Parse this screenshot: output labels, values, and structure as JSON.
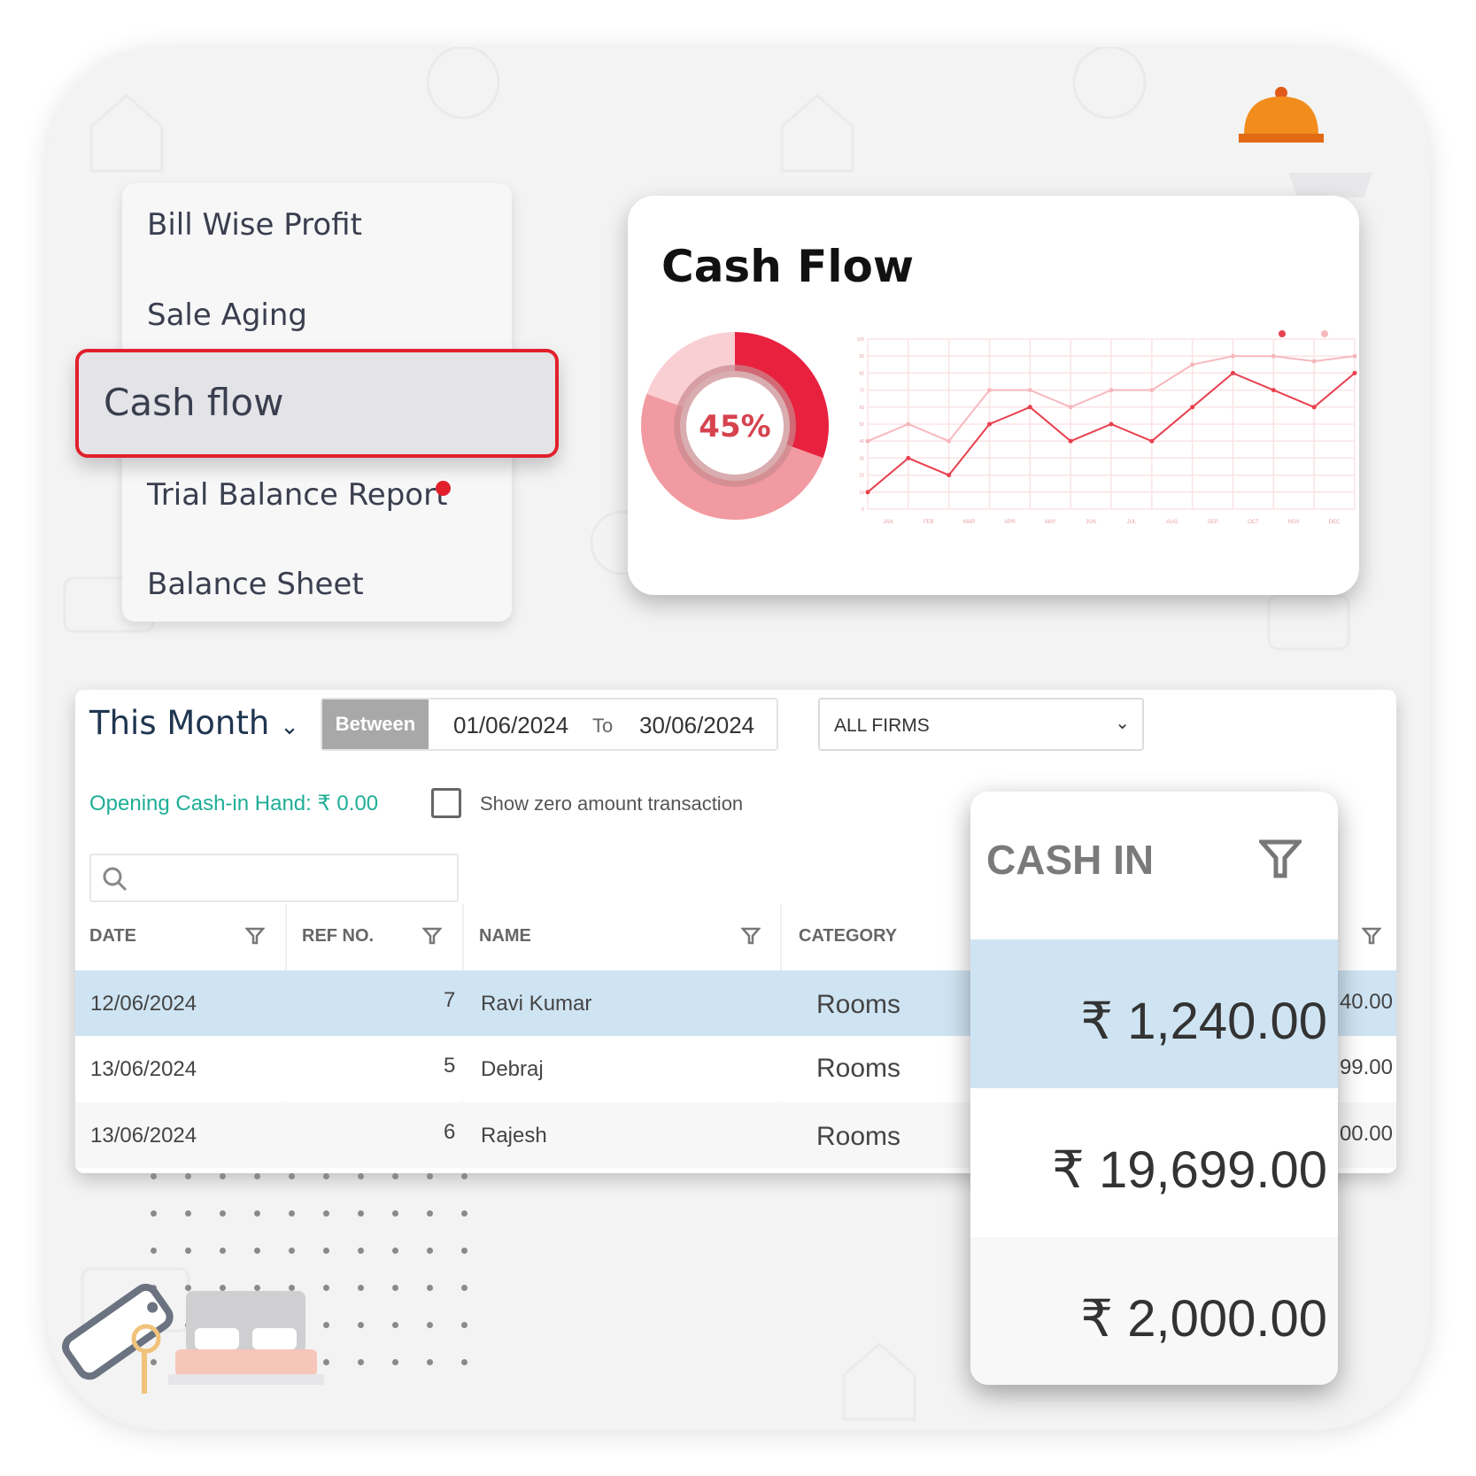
{
  "menu": {
    "items": [
      {
        "label": "Bill Wise Profit"
      },
      {
        "label": "Sale Aging"
      },
      {
        "label": "Cash flow",
        "selected": true
      },
      {
        "label": "Trial Balance Report",
        "has_notification": true
      },
      {
        "label": "Balance Sheet"
      }
    ]
  },
  "cash_flow_card": {
    "title": "Cash Flow",
    "donut_label": "45%"
  },
  "chart_data": {
    "type": "line",
    "categories": [
      "JAN",
      "FEB",
      "MAR",
      "APR",
      "MAY",
      "JUN",
      "JUL",
      "AUG",
      "SEP",
      "OCT",
      "NOV",
      "DEC"
    ],
    "yticks": [
      0,
      10,
      20,
      30,
      40,
      50,
      60,
      70,
      80,
      90,
      100
    ],
    "ylim": [
      0,
      100
    ],
    "grid": true,
    "legend": "top-right",
    "series": [
      {
        "values": [
          10,
          30,
          20,
          50,
          60,
          40,
          50,
          40,
          60,
          80,
          70,
          60,
          80
        ],
        "color": "#e8414f"
      },
      {
        "values": [
          40,
          50,
          40,
          70,
          70,
          60,
          70,
          70,
          85,
          90,
          90,
          87,
          90
        ],
        "color": "#f6b8bd"
      }
    ]
  },
  "donut": {
    "value_percent": 45,
    "colors": [
      "#e8213f",
      "#f29aa1",
      "#f9cfd3"
    ]
  },
  "filters": {
    "period": "This Month",
    "between_label": "Between",
    "from_date": "01/06/2024",
    "to_label": "To",
    "to_date": "30/06/2024",
    "firm": "ALL FIRMS",
    "opening_cash": "Opening Cash-in Hand: ₹ 0.00",
    "show_zero_label": "Show zero amount transaction",
    "show_zero_checked": false,
    "search_value": ""
  },
  "table": {
    "columns": [
      "DATE",
      "REF NO.",
      "NAME",
      "CATEGORY"
    ],
    "rows": [
      {
        "date": "12/06/2024",
        "ref": "7",
        "name": "Ravi Kumar",
        "category": "Rooms",
        "partial": "40.00",
        "selected": true
      },
      {
        "date": "13/06/2024",
        "ref": "5",
        "name": "Debraj",
        "category": "Rooms",
        "partial": "99.00"
      },
      {
        "date": "13/06/2024",
        "ref": "6",
        "name": "Rajesh",
        "category": "Rooms",
        "partial": "00.00"
      }
    ]
  },
  "cash_in": {
    "title": "CASH IN",
    "values": [
      "₹ 1,240.00",
      "₹ 19,699.00",
      "₹ 2,000.00"
    ]
  },
  "colors": {
    "accent": "#e1202c",
    "selected_row": "#cfe4f3",
    "teal": "#1fae96"
  }
}
